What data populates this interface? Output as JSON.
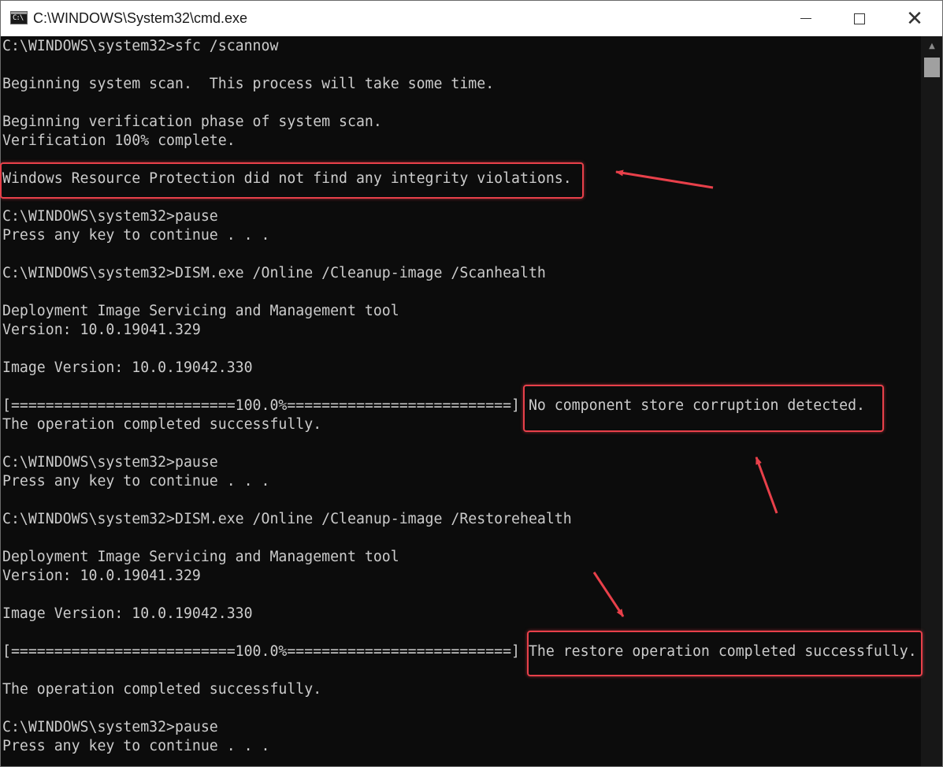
{
  "window": {
    "title": "C:\\WINDOWS\\System32\\cmd.exe",
    "icon_label": "C:\\",
    "controls": {
      "minimize": "minimize-icon",
      "maximize": "maximize-icon",
      "close": "close-icon"
    }
  },
  "console": {
    "lines": [
      "C:\\WINDOWS\\system32>sfc /scannow",
      "",
      "Beginning system scan.  This process will take some time.",
      "",
      "Beginning verification phase of system scan.",
      "Verification 100% complete.",
      "",
      "Windows Resource Protection did not find any integrity violations.",
      "",
      "C:\\WINDOWS\\system32>pause",
      "Press any key to continue . . .",
      "",
      "C:\\WINDOWS\\system32>DISM.exe /Online /Cleanup-image /Scanhealth",
      "",
      "Deployment Image Servicing and Management tool",
      "Version: 10.0.19041.329",
      "",
      "Image Version: 10.0.19042.330",
      "",
      "[==========================100.0%==========================] No component store corruption detected.",
      "The operation completed successfully.",
      "",
      "C:\\WINDOWS\\system32>pause",
      "Press any key to continue . . .",
      "",
      "C:\\WINDOWS\\system32>DISM.exe /Online /Cleanup-image /Restorehealth",
      "",
      "Deployment Image Servicing and Management tool",
      "Version: 10.0.19041.329",
      "",
      "Image Version: 10.0.19042.330",
      "",
      "[==========================100.0%==========================] The restore operation completed successfully.",
      "",
      "The operation completed successfully.",
      "",
      "C:\\WINDOWS\\system32>pause",
      "Press any key to continue . . ."
    ]
  },
  "annotations": {
    "highlight_color": "#e8404a",
    "highlights": [
      "Windows Resource Protection did not find any integrity violations.",
      "No component store corruption detected.",
      "The restore operation completed successfully."
    ]
  },
  "colors": {
    "console_background": "#0c0c0c",
    "console_text": "#cccccc",
    "titlebar_background": "#ffffff"
  }
}
